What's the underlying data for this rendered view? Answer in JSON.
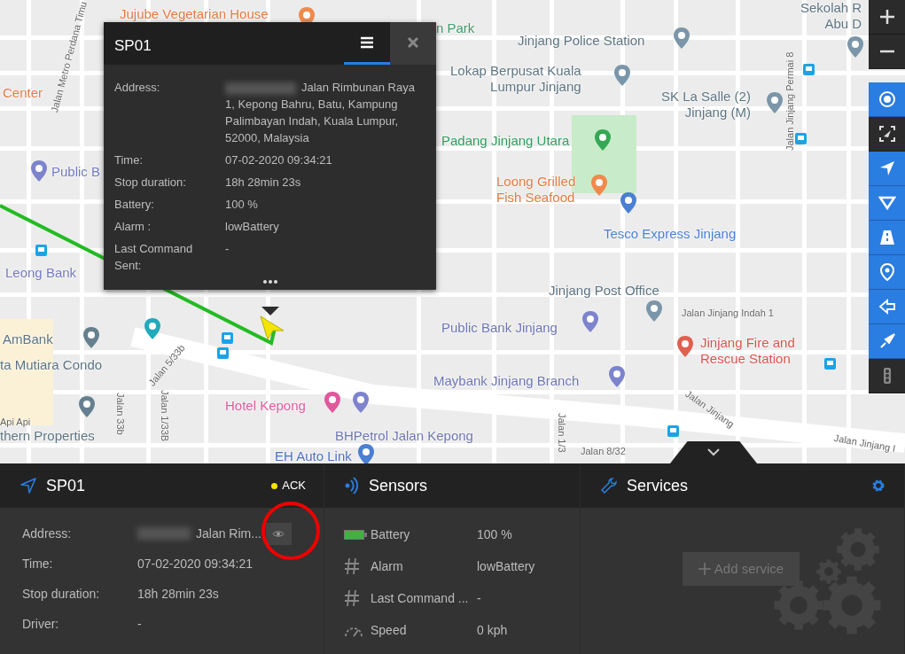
{
  "map": {
    "labels": [
      {
        "kind": "place",
        "lines": [
          "Jujube Vegetarian House"
        ],
        "color": "#e4793f"
      },
      {
        "kind": "place",
        "lines": [
          "Center"
        ],
        "color": "#e4793f"
      },
      {
        "kind": "place",
        "lines": [
          "Public B"
        ],
        "color": "#7379c0"
      },
      {
        "kind": "place",
        "lines": [
          "Leong Bank"
        ],
        "color": "#7379c0"
      },
      {
        "kind": "place",
        "lines": [
          "AmBank"
        ],
        "color": "#5d7482"
      },
      {
        "kind": "place",
        "lines": [
          "ta Mutiara Condo"
        ],
        "color": "#5d7482"
      },
      {
        "kind": "road",
        "lines": [
          "Api Api"
        ],
        "color": "#666666"
      },
      {
        "kind": "place",
        "lines": [
          "thern Properties"
        ],
        "color": "#5d7482"
      },
      {
        "kind": "road",
        "lines": [
          "Jalan 5/33b"
        ],
        "color": "#666666"
      },
      {
        "kind": "road",
        "lines": [
          "Jalan 33b"
        ],
        "color": "#666666"
      },
      {
        "kind": "road",
        "lines": [
          "Jalan 1/33B"
        ],
        "color": "#666666"
      },
      {
        "kind": "place",
        "lines": [
          "Hotel Kepong"
        ],
        "color": "#e0589c"
      },
      {
        "kind": "place",
        "lines": [
          "BHPetrol Jalan Kepong"
        ],
        "color": "#6d75b5"
      },
      {
        "kind": "place",
        "lines": [
          "EH Auto Link"
        ],
        "color": "#4a6fc2"
      },
      {
        "kind": "place",
        "lines": [
          "n Park"
        ],
        "color": "#3b9b6a"
      },
      {
        "kind": "place",
        "lines": [
          "Jinjang Police Station"
        ],
        "color": "#5d7482"
      },
      {
        "kind": "place",
        "lines": [
          "Lokap Berpusat Kuala",
          "Lumpur Jinjang"
        ],
        "color": "#5d7482"
      },
      {
        "kind": "place",
        "lines": [
          "SK La Salle (2)",
          "Jinjang (M)"
        ],
        "color": "#5d7482"
      },
      {
        "kind": "place",
        "lines": [
          "Padang Jinjang Utara"
        ],
        "color": "#2f9b5c"
      },
      {
        "kind": "place",
        "lines": [
          "Loong Grilled",
          "Fish Seafood"
        ],
        "color": "#e4793f"
      },
      {
        "kind": "place",
        "lines": [
          "Tesco Express Jinjang"
        ],
        "color": "#4a7fd3"
      },
      {
        "kind": "place",
        "lines": [
          "Jinjang Post Office"
        ],
        "color": "#5d7482"
      },
      {
        "kind": "road",
        "lines": [
          "Jalan Jinjang Indah 1"
        ],
        "color": "#666666"
      },
      {
        "kind": "place",
        "lines": [
          "Public Bank Jinjang"
        ],
        "color": "#6d75b5"
      },
      {
        "kind": "place",
        "lines": [
          "Jinjang Fire and",
          "Rescue Station"
        ],
        "color": "#d9534f"
      },
      {
        "kind": "place",
        "lines": [
          "Maybank Jinjang Branch"
        ],
        "color": "#6d75b5"
      },
      {
        "kind": "road",
        "lines": [
          "Jalan Jinjang"
        ],
        "color": "#666666"
      },
      {
        "kind": "road",
        "lines": [
          "Jalan Jinjang Permai 8"
        ],
        "color": "#666666"
      },
      {
        "kind": "place",
        "lines": [
          "Sekolah R",
          "Abu D"
        ],
        "color": "#5d7482"
      },
      {
        "kind": "road",
        "lines": [
          "Jalan Jinjang I"
        ],
        "color": "#666666"
      },
      {
        "kind": "road",
        "lines": [
          "Jalan 8/32"
        ],
        "color": "#666666"
      },
      {
        "kind": "road",
        "lines": [
          "Jalan 1/3"
        ],
        "color": "#666666"
      },
      {
        "kind": "road",
        "lines": [
          "Jalan Metro Perdana Timu"
        ],
        "color": "#666666"
      }
    ]
  },
  "map_tools": [
    {
      "kind": "zoom-in"
    },
    {
      "kind": "zoom-out"
    },
    {
      "kind": "clusters",
      "selected": true
    },
    {
      "kind": "fit",
      "selected": false
    },
    {
      "kind": "objects",
      "selected": true
    },
    {
      "kind": "routes",
      "selected": true
    },
    {
      "kind": "road",
      "selected": true
    },
    {
      "kind": "poi",
      "selected": true
    },
    {
      "kind": "history",
      "selected": true
    },
    {
      "kind": "follow",
      "selected": true
    },
    {
      "kind": "traffic",
      "selected": false
    }
  ],
  "popup": {
    "title": "SP01",
    "tabs": [
      {
        "kind": "menu",
        "selected": true
      },
      {
        "kind": "close",
        "selected": false
      }
    ],
    "rows": [
      {
        "label": "Address:",
        "value": "Jalan Rimbunan Raya 1, Kepong Bahru, Batu, Kampung Palimbayan Indah, Kuala Lumpur, 52000, Malaysia",
        "redacted": true
      },
      {
        "label": "Time:",
        "value": "07-02-2020 09:34:21",
        "redacted": false
      },
      {
        "label": "Stop duration:",
        "value": "18h 28min 23s",
        "redacted": false
      },
      {
        "label": "Battery:",
        "value": "100 %",
        "redacted": false
      },
      {
        "label": "Alarm :",
        "value": "lowBattery",
        "redacted": false
      },
      {
        "label": "Last Command Sent:",
        "value": "-",
        "redacted": false
      }
    ]
  },
  "object_panel": {
    "title": "SP01",
    "status": {
      "label": "ACK",
      "color": "#f5e400"
    },
    "rows": [
      {
        "label": "Address:",
        "value": "Jalan Rim...",
        "redacted": true
      },
      {
        "label": "Time:",
        "value": "07-02-2020 09:34:21",
        "redacted": false
      },
      {
        "label": "Stop duration:",
        "value": "18h 28min 23s",
        "redacted": false
      },
      {
        "label": "Driver:",
        "value": "-",
        "redacted": false
      }
    ]
  },
  "sensors": {
    "title": "Sensors",
    "rows": [
      {
        "kind": "battery",
        "label": "Battery",
        "value": "100 %",
        "level": 1
      },
      {
        "kind": "text",
        "label": "Alarm",
        "value": "lowBattery"
      },
      {
        "kind": "text",
        "label": "Last Command ...",
        "value": "-"
      },
      {
        "kind": "speed",
        "label": "Speed",
        "value": "0 kph"
      }
    ]
  },
  "services": {
    "title": "Services",
    "add_button": "Add service",
    "add_disabled": true
  }
}
